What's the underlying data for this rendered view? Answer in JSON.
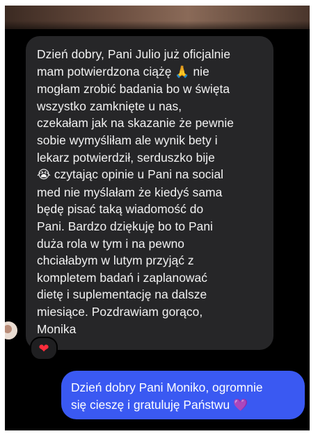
{
  "incoming_message": {
    "lines": [
      "Dzień dobry, Pani Julio już oficjalnie",
      "mam potwierdzona ciążę",
      "mogłam zrobić badania bo w święta",
      "wszystko zamknięte u nas,",
      "czekałam jak na skazanie że pewnie",
      "sobie wymyśliłam ale wynik bety i",
      "lekarz potwierdził, serduszko bije",
      "czytając opinie u Pani na social",
      "med nie myślałam że kiedyś sama",
      "będę pisać taką wiadomość do",
      "Pani. Bardzo dziękuję bo to Pani",
      "duża rola w tym i na pewno",
      "chciałabym w lutym przyjąć z",
      "kompletem badań i zaplanować",
      "dietę i suplementację na dalsze",
      "miesiące. Pozdrawiam gorąco,",
      "Monika"
    ],
    "pray_emoji": "🙏",
    "after_pray": " nie",
    "cry_emoji": "😭",
    "reaction": "❤"
  },
  "outgoing_message": {
    "line1": "Dzień dobry Pani Moniko, ogromnie",
    "line2": "się cieszę i gratuluję Państwu",
    "heart_emoji": "💜"
  },
  "colors": {
    "background": "#000000",
    "incoming_bubble": "#262628",
    "outgoing_bubble": "#3a59f2",
    "reaction_heart": "#ff2d3c"
  }
}
